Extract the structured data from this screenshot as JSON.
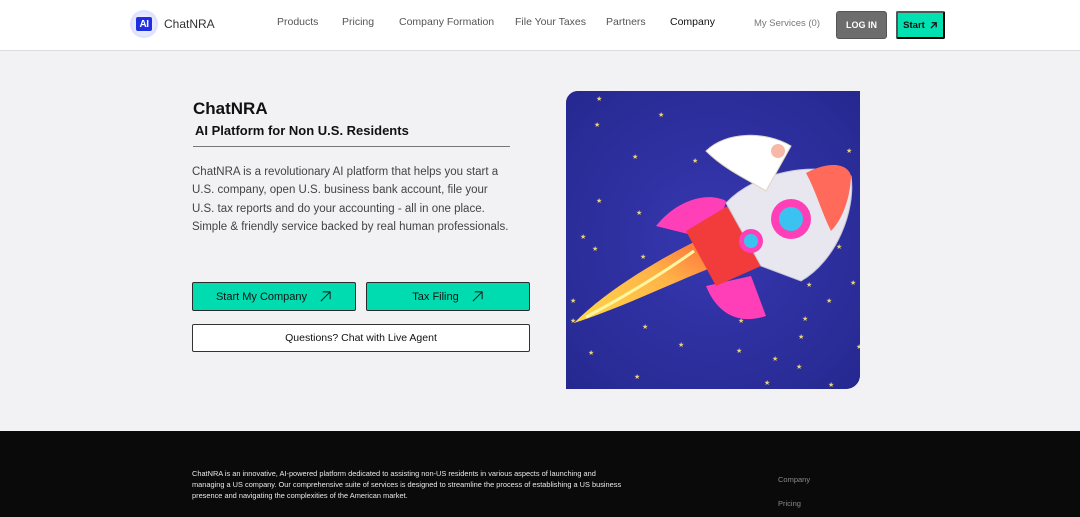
{
  "brand": {
    "name": "ChatNRA",
    "logo_glyph": "AI",
    "accent": "#00dcb0",
    "logo_color": "#1f2fe0"
  },
  "nav": {
    "items": [
      {
        "label": "Products"
      },
      {
        "label": "Pricing"
      },
      {
        "label": "Company Formation"
      },
      {
        "label": "File Your Taxes"
      },
      {
        "label": "Partners"
      },
      {
        "label": "Company",
        "active": true
      }
    ],
    "my_services": "My Services (0)",
    "login": "LOG IN",
    "start": "Start",
    "start_icon": "arrow-up-right-icon"
  },
  "hero": {
    "title": "ChatNRA",
    "subtitle": "AI Platform for Non U.S. Residents",
    "description": "ChatNRA is a revolutionary AI platform that helps you start a U.S. company, open U.S. business bank account, file your U.S. tax reports and do your accounting - all in one place. Simple & friendly service backed by real human professionals.",
    "btn_company": "Start My Company",
    "btn_tax": "Tax Filing",
    "btn_chat": "Questions? Chat with Live Agent",
    "image": "rocket-illustration"
  },
  "footer": {
    "about": "ChatNRA is an innovative, AI-powered platform dedicated to assisting non-US residents in various aspects of launching and managing a US company. Our comprehensive suite of services is designed to streamline the process of establishing a US business presence and navigating the complexities of the American market.",
    "links": [
      {
        "label": "Company"
      },
      {
        "label": "Pricing"
      }
    ]
  }
}
